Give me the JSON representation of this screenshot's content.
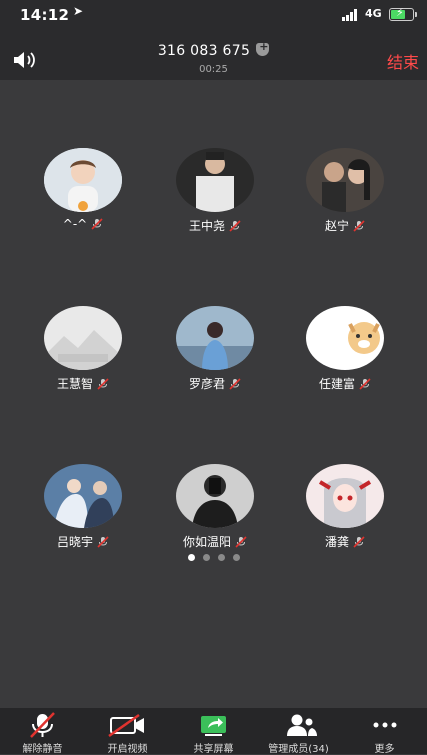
{
  "status_bar": {
    "time": "14:12",
    "network": "4G"
  },
  "header": {
    "meeting_id": "316 083 675",
    "duration": "00:25",
    "end_label": "结束"
  },
  "participants": [
    {
      "name": "^-^"
    },
    {
      "name": "王中尧"
    },
    {
      "name": "赵宁"
    },
    {
      "name": "王慧智"
    },
    {
      "name": "罗彦君"
    },
    {
      "name": "任建富"
    },
    {
      "name": "吕晓宇"
    },
    {
      "name": "你如温阳"
    },
    {
      "name": "潘龚"
    }
  ],
  "pager": {
    "pages": 4,
    "current": 1
  },
  "toolbar": {
    "unmute": "解除静音",
    "start_video": "开启视频",
    "share_screen": "共享屏幕",
    "manage_members": "管理成员(34)",
    "more": "更多"
  },
  "colors": {
    "end": "#ff4a4a",
    "battery": "#4cd964",
    "mute_slash": "#e0332f",
    "share": "#3bbf5a"
  }
}
